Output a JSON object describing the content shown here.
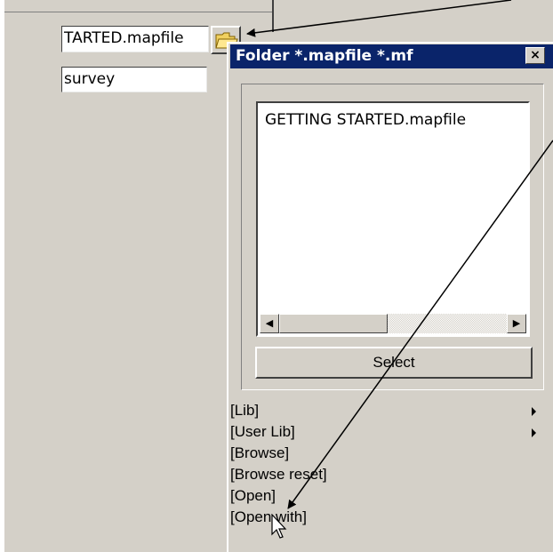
{
  "form": {
    "mapfile_value": "TARTED.mapfile",
    "project_value": "survey"
  },
  "dialog": {
    "title": "Folder *.mapfile *.mf",
    "close_label": "×",
    "files": [
      "GETTING STARTED.mapfile"
    ],
    "select_label": "Select",
    "scroll_left": "◀",
    "scroll_right": "▶"
  },
  "menu": {
    "items": [
      {
        "label": "[Lib]",
        "submenu": true
      },
      {
        "label": "[User Lib]",
        "submenu": true
      },
      {
        "label": "[Browse]",
        "submenu": false
      },
      {
        "label": "[Browse reset]",
        "submenu": false
      },
      {
        "label": "[Open]",
        "submenu": false
      },
      {
        "label": "[Open with]",
        "submenu": false
      }
    ]
  },
  "colors": {
    "titlebar": "#0a246a",
    "face": "#d4d0c8"
  },
  "icons": {
    "folder": "folder-open-icon",
    "cursor": "mouse-pointer-icon"
  }
}
